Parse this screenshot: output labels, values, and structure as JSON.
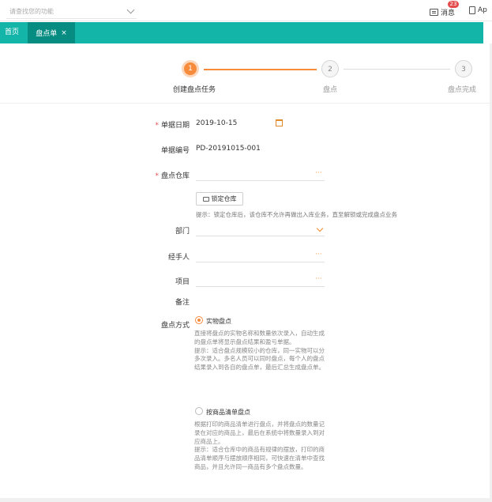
{
  "topbar": {
    "search_placeholder": "请查找您的功能",
    "messages_label": "消息",
    "messages_badge": "23",
    "app_label": "Ap"
  },
  "tabs": {
    "home_label": "首页",
    "active_label": "盘点单",
    "close_symbol": "×"
  },
  "steps": [
    {
      "number": "1",
      "label": "创建盘点任务"
    },
    {
      "number": "2",
      "label": "盘点"
    },
    {
      "number": "3",
      "label": "盘点完成"
    }
  ],
  "form": {
    "date_label": "单据日期",
    "date_value": "2019-10-15",
    "number_label": "单据编号",
    "number_value": "PD-20191015-001",
    "warehouse_label": "盘点仓库",
    "lock_button_label": "锁定仓库",
    "tip_text": "提示：锁定仓库后，该仓库不允许再做出入库业务，直至解锁或完成盘点业务",
    "dept_label": "部门",
    "handler_label": "经手人",
    "project_label": "项目",
    "remark_label": "备注",
    "method_label": "盘点方式",
    "dots": "···",
    "required_mark": "*"
  },
  "methods": [
    {
      "label": "实物盘点",
      "selected": true,
      "desc_main": "直接将盘点的实物名称和数量依次录入，自动生成的盘点单将显示盘点结果和盈亏单据。",
      "desc_tip": "提示：适合盘点规模较小的仓库，同一实物可以分多次录入。多名人员可以同时盘点，每个人的盘点结果录入到各自的盘点单，最后汇总生成盘点单。"
    },
    {
      "label": "按商品清单盘点",
      "selected": false,
      "desc_main": "根据打印的商品清单进行盘点，并将盘点的数量记录在对应的商品上，最后在系统中将数量录入到对应商品上。",
      "desc_tip": "提示：适合仓库中的商品有规律的摆放，打印的商品清单顺序与摆放顺序相同，可快速在清单中查找商品，并且允许同一商品有多个盘点数量。"
    }
  ],
  "colors": {
    "teal": "#13b5a8",
    "teal_dark": "#078c82",
    "orange": "#f78b3c",
    "badge_red": "#e34d4d"
  }
}
